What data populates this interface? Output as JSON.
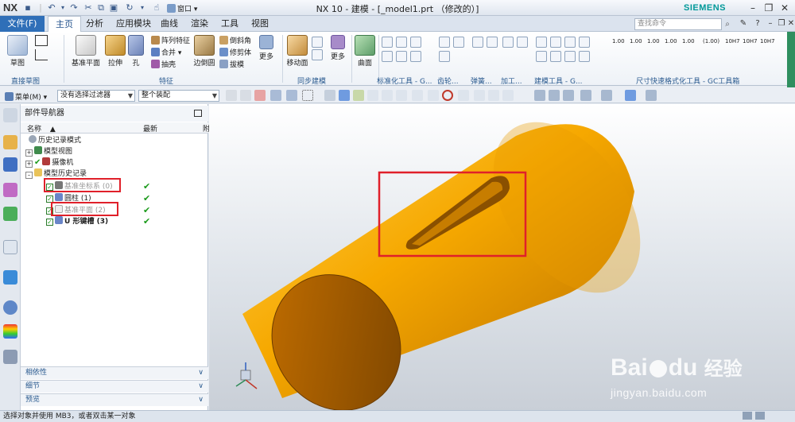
{
  "titlebar": {
    "logo": "NX",
    "title": "NX 10 - 建模 - [_model1.prt （修改的）]",
    "brand": "SIEMENS",
    "window_menu": "窗口"
  },
  "menubar": {
    "file": "文件(F)",
    "tabs": [
      "主页",
      "分析",
      "应用模块",
      "曲线",
      "渲染",
      "工具",
      "视图"
    ],
    "search_placeholder": "查找命令"
  },
  "ribbon": {
    "sketch": "草图",
    "datum_plane": "基准平面",
    "extrude": "拉伸",
    "hole": "孔",
    "pattern_feature": "阵列特征",
    "unite": "合并",
    "shell": "抽壳",
    "edge_blend": "边倒圆",
    "chamfer": "倒斜角",
    "trim_body": "修剪体",
    "draft": "拔模",
    "more1": "更多",
    "move_face": "移动面",
    "more2": "更多",
    "surface": "曲面",
    "groups": {
      "direct_sketch": "直接草图",
      "feature": "特征",
      "sync_modeling": "同步建模",
      "standard_tools": "标准化工具 - G...",
      "gear": "齿轮...",
      "spring": "弹簧...",
      "machining": "加工...",
      "modeling_tools": "建模工具 - G...",
      "dimension_tools": "尺寸快速格式化工具 - GC工具箱"
    },
    "dim_labels": [
      "1.00",
      "1.00",
      "1.00",
      "1.00",
      "1.00",
      "(1.00)",
      "10H7",
      "10H7",
      "10H7"
    ]
  },
  "toolbar2": {
    "menu": "菜单(M)",
    "filter": "没有选择过滤器",
    "assembly": "整个装配"
  },
  "navigator": {
    "title": "部件导航器",
    "col_name": "名称",
    "col_latest": "最新",
    "col_extra": "附",
    "rows": [
      {
        "label": "历史记录模式"
      },
      {
        "label": "模型视图"
      },
      {
        "label": "摄像机"
      },
      {
        "label": "模型历史记录"
      },
      {
        "label": "基准坐标系 (0)",
        "latest": "✔"
      },
      {
        "label": "圆柱 (1)",
        "latest": "✔"
      },
      {
        "label": "基准平面 (2)",
        "latest": "✔"
      },
      {
        "label": "U 形键槽 (3)",
        "latest": "✔"
      }
    ],
    "panels": [
      "相依性",
      "细节",
      "预览"
    ]
  },
  "statusbar": {
    "text": "选择对象并使用 MB3，或者双击某一对象"
  },
  "watermark": {
    "brand": "Bai",
    "brand2": "du",
    "cn": "经验",
    "url": "jingyan.baidu.com"
  },
  "colors": {
    "accent": "#2f6fb8",
    "model": "#f2a400",
    "highlight": "#e0202a",
    "ok": "#1a9a1a"
  }
}
